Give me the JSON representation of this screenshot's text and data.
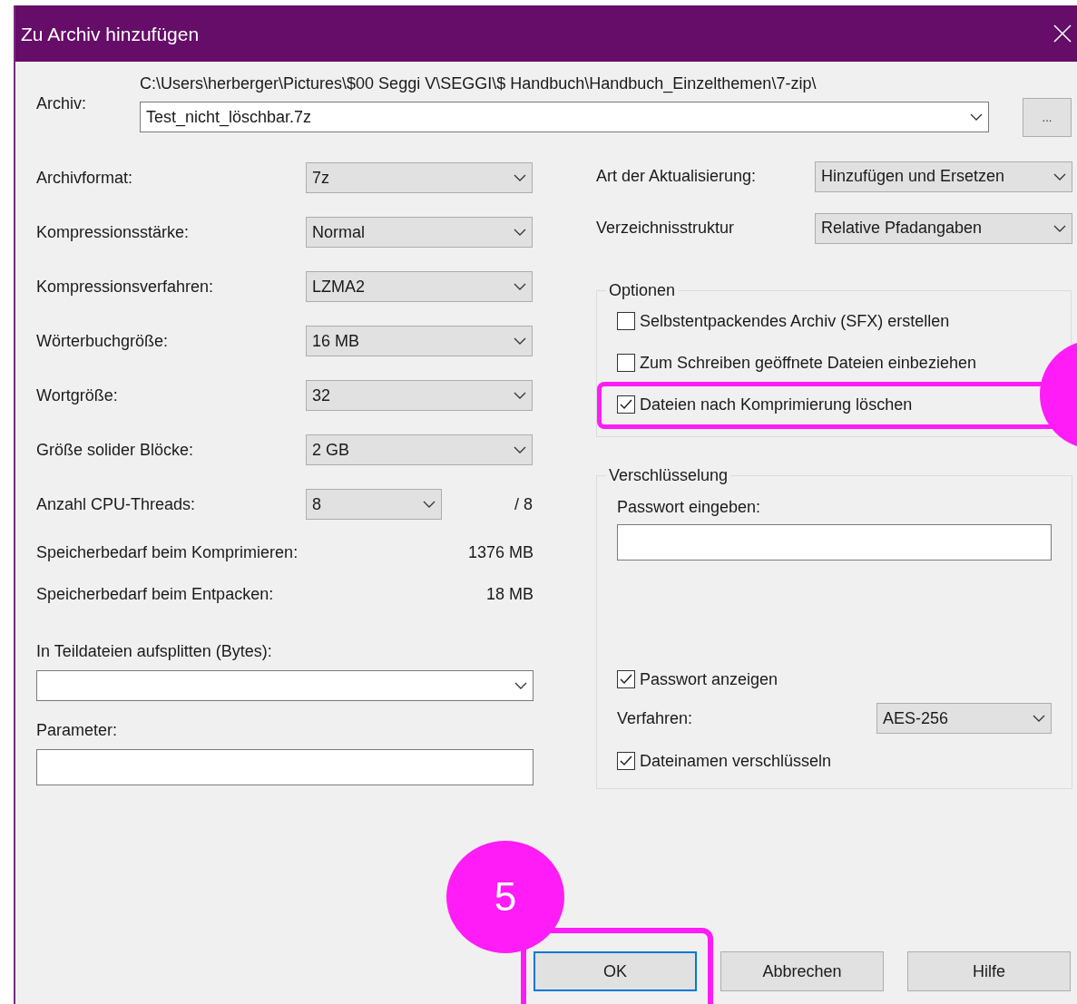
{
  "window": {
    "title": "Zu Archiv hinzufügen"
  },
  "archive": {
    "label": "Archiv:",
    "path": "C:\\Users\\herberger\\Pictures\\$00 Seggi V\\SEGGI\\$ Handbuch\\Handbuch_Einzelthemen\\7-zip\\",
    "value": "Test_nicht_löschbar.7z",
    "browse": "..."
  },
  "settings": [
    {
      "label": "Archivformat:",
      "value": "7z"
    },
    {
      "label": "Kompressionsstärke:",
      "value": "Normal"
    },
    {
      "label": "Kompressionsverfahren:",
      "value": "LZMA2"
    },
    {
      "label": "Wörterbuchgröße:",
      "value": "16 MB"
    },
    {
      "label": "Wortgröße:",
      "value": "32"
    },
    {
      "label": "Größe solider Blöcke:",
      "value": "2 GB"
    }
  ],
  "threads": {
    "label": "Anzahl CPU-Threads:",
    "value": "8",
    "suffix": "/ 8"
  },
  "memory": [
    {
      "label": "Speicherbedarf beim Komprimieren:",
      "value": "1376 MB"
    },
    {
      "label": "Speicherbedarf beim Entpacken:",
      "value": "18 MB"
    }
  ],
  "split": {
    "label": "In Teildateien aufsplitten (Bytes):"
  },
  "parameter": {
    "label": "Parameter:"
  },
  "update_mode": {
    "label": "Art der Aktualisierung:",
    "value": "Hinzufügen und Ersetzen"
  },
  "path_mode": {
    "label": "Verzeichnisstruktur",
    "value": "Relative Pfadangaben"
  },
  "options": {
    "title": "Optionen",
    "items": [
      {
        "label": "Selbstentpackendes Archiv (SFX) erstellen",
        "checked": false,
        "highlighted": false
      },
      {
        "label": "Zum Schreiben geöffnete Dateien einbeziehen",
        "checked": false,
        "highlighted": false
      },
      {
        "label": "Dateien nach Komprimierung löschen",
        "checked": true,
        "highlighted": true
      }
    ]
  },
  "encryption": {
    "title": "Verschlüsselung",
    "password_label": "Passwort eingeben:",
    "show_password": {
      "label": "Passwort anzeigen",
      "checked": true
    },
    "method": {
      "label": "Verfahren:",
      "value": "AES-256"
    },
    "encrypt_names": {
      "label": "Dateinamen verschlüsseln",
      "checked": true
    }
  },
  "buttons": [
    {
      "label": "OK",
      "focused": true,
      "highlighted": true
    },
    {
      "label": "Abbrechen",
      "focused": false,
      "highlighted": false
    },
    {
      "label": "Hilfe",
      "focused": false,
      "highlighted": false
    }
  ],
  "step_badge": {
    "text": "5"
  }
}
